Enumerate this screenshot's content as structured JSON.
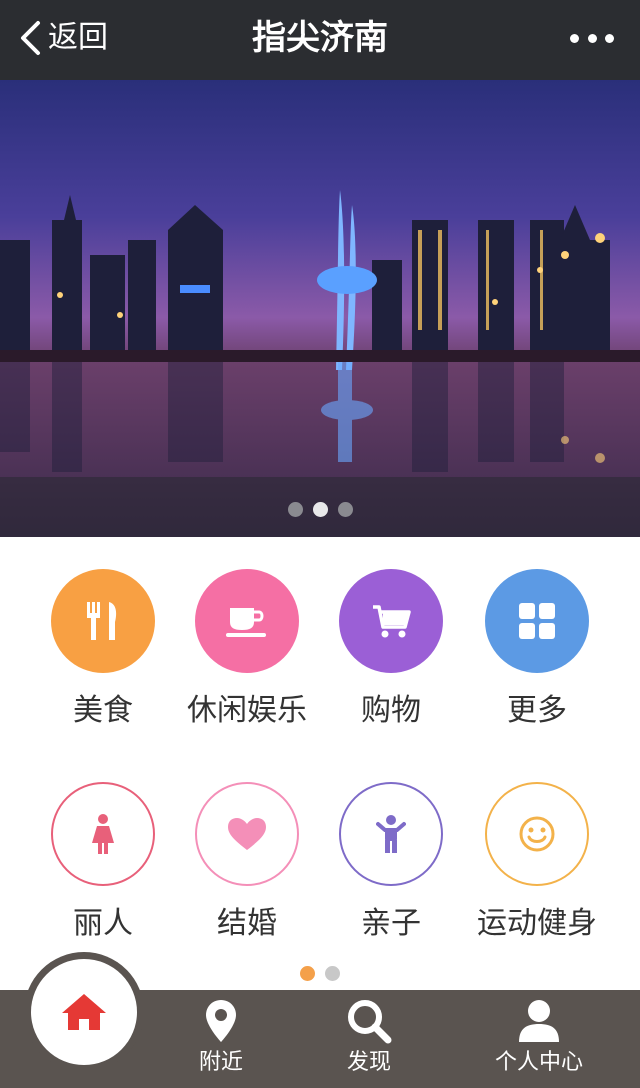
{
  "topbar": {
    "back_label": "返回",
    "title": "指尖济南"
  },
  "banner": {
    "slide_count": 3,
    "active_slide": 2
  },
  "categories": [
    {
      "label": "美食",
      "icon": "fork-knife-icon",
      "color": "#f8a043",
      "style": "filled"
    },
    {
      "label": "休闲娱乐",
      "icon": "coffee-cup-icon",
      "color": "#f56fa4",
      "style": "filled"
    },
    {
      "label": "购物",
      "icon": "shopping-cart-icon",
      "color": "#9b5fd6",
      "style": "filled"
    },
    {
      "label": "更多",
      "icon": "grid-icon",
      "color": "#5c9ae4",
      "style": "filled"
    },
    {
      "label": "丽人",
      "icon": "woman-icon",
      "color": "#e8607a",
      "style": "outline"
    },
    {
      "label": "结婚",
      "icon": "heart-icon",
      "color": "#f48fb8",
      "style": "outline"
    },
    {
      "label": "亲子",
      "icon": "child-icon",
      "color": "#7e6bc8",
      "style": "outline"
    },
    {
      "label": "运动健身",
      "icon": "smiley-icon",
      "color": "#f3b24a",
      "style": "outline"
    }
  ],
  "category_pages": {
    "count": 2,
    "active": 1
  },
  "tabbar": {
    "home_icon": "home-icon",
    "home_color": "#e53935",
    "tabs": [
      {
        "label": "附近",
        "icon": "location-pin-icon"
      },
      {
        "label": "发现",
        "icon": "search-icon"
      },
      {
        "label": "个人中心",
        "icon": "user-icon"
      }
    ]
  }
}
